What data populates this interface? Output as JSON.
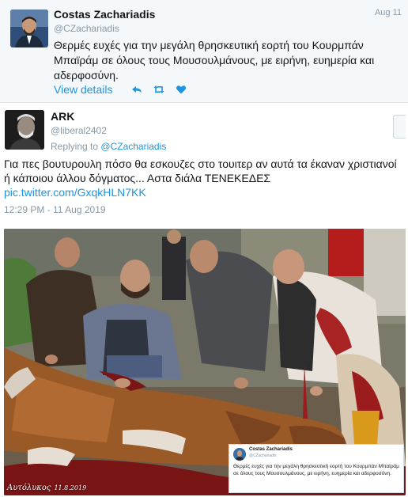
{
  "parent_tweet": {
    "author_name": "Costas Zachariadis",
    "author_handle": "@CZachariadis",
    "date": "Aug 11",
    "text": "Θερμές ευχές για την μεγάλη θρησκευτική εορτή του Κουρμπάν Μπαϊράμ σε όλους τους Μουσουλμάνους, με ειρήνη, ευημερία και αδερφοσύνη.",
    "view_details_label": "View details",
    "icons": [
      "reply-icon",
      "retweet-icon",
      "like-icon"
    ],
    "accent_color": "#1b95e0"
  },
  "reply_tweet": {
    "author_name": "ARK",
    "author_handle": "@liberal2402",
    "replying_prefix": "Replying to",
    "replying_to": "@CZachariadis",
    "text": "Για πες βουτυρουλη πόσο θα εσκουζες στο τουιτερ αν αυτά τα έκαναν χριστιανοί ή κάποιου άλλου δόγματος... Αστα διάλα ΤΕΝΕΚΕΔΕΣ",
    "pic_link": "pic.twitter.com/GxqkHLN7KK",
    "timestamp": "12:29 PM - 11 Aug 2019"
  },
  "photo": {
    "watermark_name": "Αυτόλυκος",
    "watermark_date": "11.8.2019",
    "embedded_tweet": {
      "author_name": "Costas Zachariadis",
      "author_handle": "@CZachariadis",
      "text": "Θερμές ευχές για την μεγάλη θρησκευτική εορτή του Κουρμπάν Μπαϊράμ σε όλους τους Μουσουλμάνους, με ειρήνη, ευημερία και αδερφοσύνη."
    }
  }
}
